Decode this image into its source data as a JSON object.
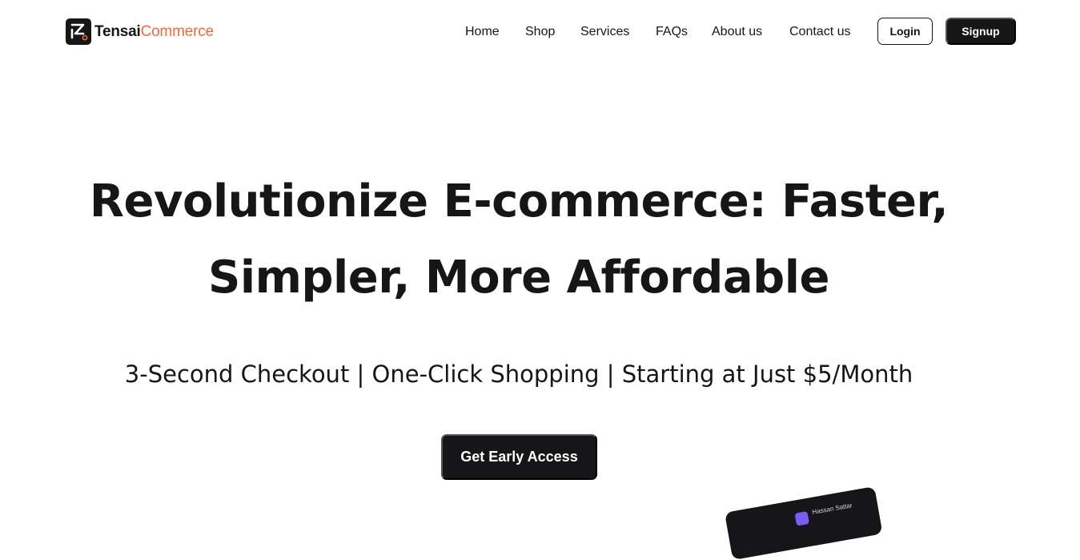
{
  "brand": {
    "name_primary": "Tensai",
    "name_secondary": "Commerce",
    "accent_color": "#ee6b3b",
    "dark_color": "#161618",
    "logo_icon": "tensai-logo-icon"
  },
  "nav": {
    "items": [
      {
        "label": "Home"
      },
      {
        "label": "Shop"
      },
      {
        "label": "Services"
      },
      {
        "label": "FAQs"
      },
      {
        "label": "About us"
      },
      {
        "label": "Contact us"
      }
    ],
    "login_label": "Login",
    "signup_label": "Signup"
  },
  "hero": {
    "title_line1": "Revolutionize E-commerce: Faster,",
    "title_line2": "Simpler, More Affordable",
    "subtitle": "3-Second Checkout | One-Click Shopping | Starting at Just $5/Month",
    "cta_label": "Get Early Access"
  },
  "preview": {
    "user_name": "Hassan Sattar"
  }
}
